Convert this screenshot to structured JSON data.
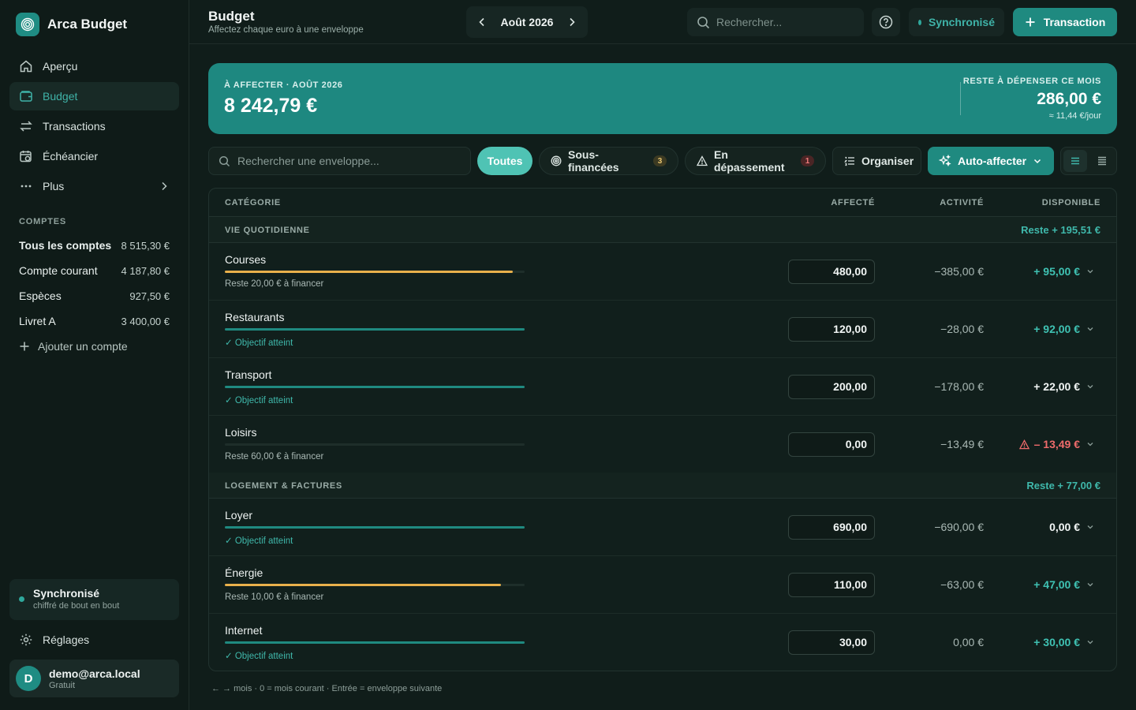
{
  "app": {
    "name": "Arca Budget"
  },
  "sidebar": {
    "nav": [
      {
        "label": "Aperçu",
        "icon": "home-icon",
        "active": false
      },
      {
        "label": "Budget",
        "icon": "wallet-icon",
        "active": true
      },
      {
        "label": "Transactions",
        "icon": "arrows-exchange-icon",
        "active": false
      },
      {
        "label": "Échéancier",
        "icon": "calendar-clock-icon",
        "active": false
      },
      {
        "label": "Plus",
        "icon": "more-dots-icon",
        "active": false
      }
    ],
    "accounts_label": "COMPTES",
    "accounts": [
      {
        "name": "Tous les comptes",
        "balance": "8 515,30 €",
        "bold": true
      },
      {
        "name": "Compte courant",
        "balance": "4 187,80 €"
      },
      {
        "name": "Espèces",
        "balance": "927,50 €"
      },
      {
        "name": "Livret A",
        "balance": "3 400,00 €"
      }
    ],
    "add_account": "Ajouter un compte",
    "sync": {
      "title": "Synchronisé",
      "subtitle": "chiffré de bout en bout"
    },
    "settings": "Réglages",
    "user": {
      "initial": "D",
      "email": "demo@arca.local",
      "plan": "Gratuit"
    }
  },
  "header": {
    "title": "Budget",
    "subtitle": "Affectez chaque euro à une enveloppe",
    "month": "Août 2026",
    "search_placeholder": "Rechercher...",
    "sync_status": "Synchronisé",
    "add_button": "Transaction"
  },
  "banner": {
    "label": "À AFFECTER · AOÛT 2026",
    "amount": "8 242,79 €",
    "right_label": "RESTE À DÉPENSER CE MOIS",
    "right_amount": "286,00 €",
    "right_per_day": "≈ 11,44 €/jour"
  },
  "toolbar": {
    "search_placeholder": "Rechercher une enveloppe...",
    "filter_all": "Toutes",
    "filter_under": "Sous-financées",
    "filter_under_count": "3",
    "filter_over": "En dépassement",
    "filter_over_count": "1",
    "organize": "Organiser",
    "auto_assign": "Auto-affecter"
  },
  "table": {
    "columns": {
      "category": "CATÉGORIE",
      "assigned": "AFFECTÉ",
      "activity": "ACTIVITÉ",
      "available": "DISPONIBLE"
    },
    "groups": [
      {
        "name": "VIE QUOTIDIENNE",
        "rest": "Reste + 195,51 €",
        "rows": [
          {
            "name": "Courses",
            "progress": 0.96,
            "bar_color": "#e9b04b",
            "status": "Reste 20,00 € à financer",
            "status_ok": false,
            "assigned": "480,00",
            "activity": "−385,00 €",
            "available": "+ 95,00 €",
            "avail_color": "#3fc2b3",
            "warn": false
          },
          {
            "name": "Restaurants",
            "progress": 1.0,
            "bar_color": "#1f8a80",
            "status": "✓ Objectif atteint",
            "status_ok": true,
            "assigned": "120,00",
            "activity": "−28,00 €",
            "available": "+ 92,00 €",
            "avail_color": "#3fc2b3",
            "warn": false
          },
          {
            "name": "Transport",
            "progress": 1.0,
            "bar_color": "#1f8a80",
            "status": "✓ Objectif atteint",
            "status_ok": true,
            "assigned": "200,00",
            "activity": "−178,00 €",
            "available": "+ 22,00 €",
            "avail_color": "#f2f6f5",
            "warn": false
          },
          {
            "name": "Loisirs",
            "progress": 0.0,
            "bar_color": "#1f8a80",
            "status": "Reste 60,00 € à financer",
            "status_ok": false,
            "assigned": "0,00",
            "activity": "−13,49 €",
            "available": "– 13,49 €",
            "avail_color": "#ef6b6b",
            "warn": true
          }
        ]
      },
      {
        "name": "LOGEMENT & FACTURES",
        "rest": "Reste + 77,00 €",
        "rows": [
          {
            "name": "Loyer",
            "progress": 1.0,
            "bar_color": "#1f8a80",
            "status": "✓ Objectif atteint",
            "status_ok": true,
            "assigned": "690,00",
            "activity": "−690,00 €",
            "available": "0,00 €",
            "avail_color": "#f2f6f5",
            "warn": false
          },
          {
            "name": "Énergie",
            "progress": 0.92,
            "bar_color": "#e9b04b",
            "status": "Reste 10,00 € à financer",
            "status_ok": false,
            "assigned": "110,00",
            "activity": "−63,00 €",
            "available": "+ 47,00 €",
            "avail_color": "#3fc2b3",
            "warn": false
          },
          {
            "name": "Internet",
            "progress": 1.0,
            "bar_color": "#1f8a80",
            "status": "✓ Objectif atteint",
            "status_ok": true,
            "assigned": "30,00",
            "activity": "0,00 €",
            "available": "+ 30,00 €",
            "avail_color": "#3fc2b3",
            "warn": false
          }
        ]
      }
    ]
  },
  "footer_hint": "← → mois · 0 = mois courant · Entrée = enveloppe suivante"
}
